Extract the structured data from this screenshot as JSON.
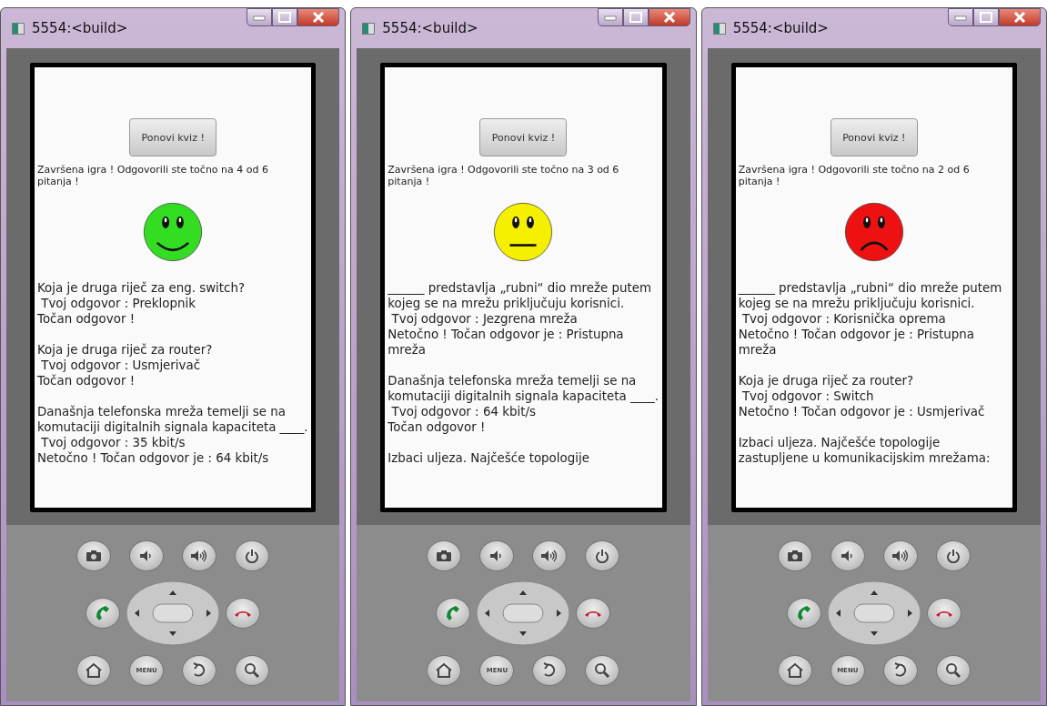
{
  "windows": [
    {
      "title": "5554:<build>",
      "button": "Ponovi kviz !",
      "summary": "Završena igra ! Odgovorili ste točno na 4 od 6 pitanja !",
      "face": {
        "kind": "happy",
        "color": "#33dd22"
      },
      "results": [
        {
          "question": "Koja je druga riječ za eng. switch?",
          "answer": " Tvoj odgovor : Preklopnik",
          "verdict": "Točan odgovor !"
        },
        {
          "question": "Koja je druga riječ za router?",
          "answer": " Tvoj odgovor : Usmjerivač",
          "verdict": "Točan odgovor !"
        },
        {
          "question": "Današnja telefonska mreža temelji se na komutaciji digitalnih signala kapaciteta ____.",
          "answer": " Tvoj odgovor : 35 kbit/s",
          "verdict": "Netočno ! Točan odgovor je : 64 kbit/s"
        }
      ],
      "menu_key": "MENU"
    },
    {
      "title": "5554:<build>",
      "button": "Ponovi kviz !",
      "summary": "Završena igra ! Odgovorili ste točno na 3 od 6 pitanja !",
      "face": {
        "kind": "neutral",
        "color": "#f5f000"
      },
      "results": [
        {
          "question": "______ predstavlja „rubni“ dio mreže putem kojeg se na mrežu priključuju korisnici.",
          "answer": " Tvoj odgovor : Jezgrena mreža",
          "verdict": "Netočno ! Točan odgovor je : Pristupna mreža"
        },
        {
          "question": "Današnja telefonska mreža temelji se na komutaciji digitalnih signala kapaciteta ____.",
          "answer": " Tvoj odgovor : 64 kbit/s",
          "verdict": "Točan odgovor !"
        },
        {
          "question": "Izbaci uljeza. Najčešće topologije"
        }
      ],
      "menu_key": "MENU"
    },
    {
      "title": "5554:<build>",
      "button": "Ponovi kviz !",
      "summary": "Završena igra ! Odgovorili ste točno na 2 od 6 pitanja !",
      "face": {
        "kind": "sad",
        "color": "#ee1111"
      },
      "results": [
        {
          "question": "______ predstavlja „rubni“ dio mreže putem kojeg se na mrežu priključuju korisnici.",
          "answer": " Tvoj odgovor : Korisnička oprema",
          "verdict": "Netočno ! Točan odgovor je : Pristupna mreža"
        },
        {
          "question": "Koja je druga riječ za router?",
          "answer": " Tvoj odgovor : Switch",
          "verdict": "Netočno ! Točan odgovor je : Usmjerivač"
        },
        {
          "question": "Izbaci uljeza. Najčešće topologije zastupljene u komunikacijskim mrežama:"
        }
      ],
      "menu_key": "MENU"
    }
  ]
}
